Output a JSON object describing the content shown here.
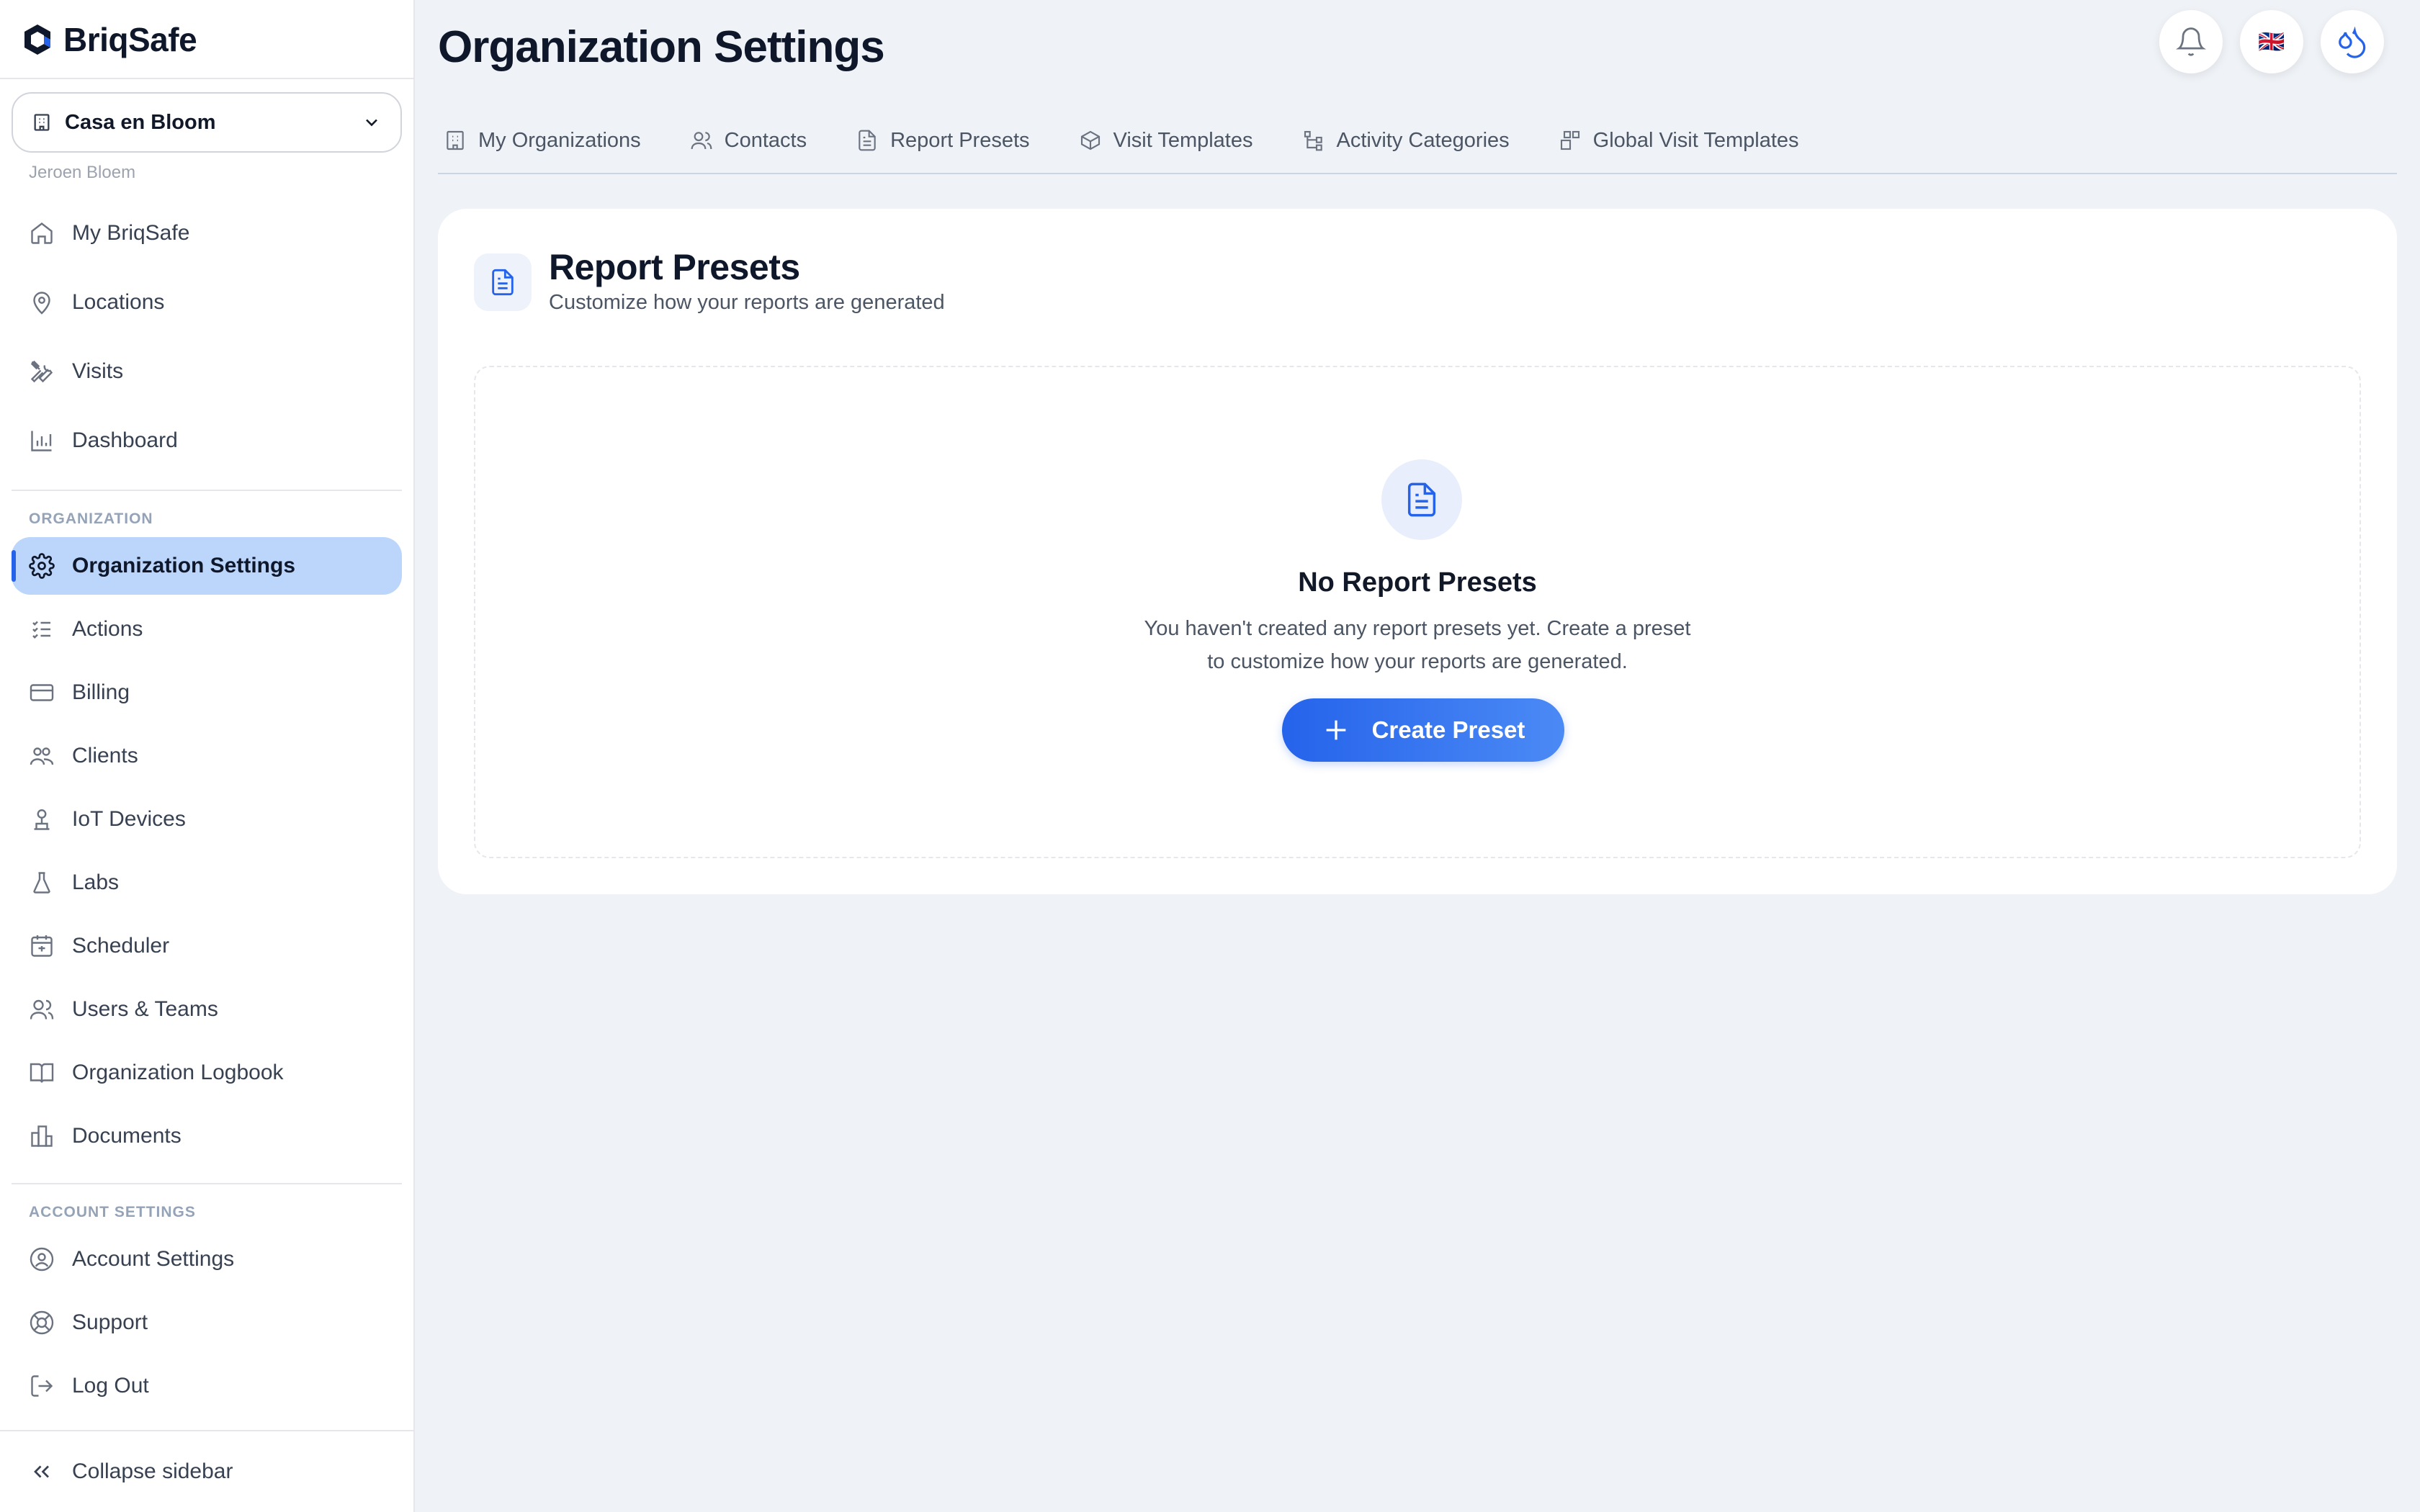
{
  "app": {
    "name": "BriqSafe"
  },
  "sidebar": {
    "org_selector": "Casa en Bloom",
    "user_name": "Jeroen Bloem",
    "main_items": [
      {
        "label": "My BriqSafe",
        "icon": "home-icon"
      },
      {
        "label": "Locations",
        "icon": "map-pin-icon"
      },
      {
        "label": "Visits",
        "icon": "tools-icon"
      },
      {
        "label": "Dashboard",
        "icon": "bar-chart-icon"
      }
    ],
    "org_section_label": "ORGANIZATION",
    "org_items": [
      {
        "label": "Organization Settings",
        "icon": "gear-icon",
        "active": true
      },
      {
        "label": "Actions",
        "icon": "checklist-icon"
      },
      {
        "label": "Billing",
        "icon": "credit-card-icon"
      },
      {
        "label": "Clients",
        "icon": "clients-icon"
      },
      {
        "label": "IoT Devices",
        "icon": "sensor-icon"
      },
      {
        "label": "Labs",
        "icon": "flask-icon"
      },
      {
        "label": "Scheduler",
        "icon": "calendar-icon"
      },
      {
        "label": "Users & Teams",
        "icon": "users-icon"
      },
      {
        "label": "Organization Logbook",
        "icon": "book-icon"
      },
      {
        "label": "Documents",
        "icon": "documents-icon"
      }
    ],
    "account_section_label": "ACCOUNT SETTINGS",
    "account_items": [
      {
        "label": "Account Settings",
        "icon": "user-circle-icon"
      },
      {
        "label": "Support",
        "icon": "lifebuoy-icon"
      },
      {
        "label": "Log Out",
        "icon": "logout-icon"
      }
    ],
    "collapse_label": "Collapse sidebar"
  },
  "header": {
    "title": "Organization Settings",
    "language_flag": "🇬🇧"
  },
  "tabs": [
    {
      "label": "My Organizations",
      "icon": "building-icon"
    },
    {
      "label": "Contacts",
      "icon": "contacts-icon"
    },
    {
      "label": "Report Presets",
      "icon": "document-icon",
      "active": true
    },
    {
      "label": "Visit Templates",
      "icon": "box-icon"
    },
    {
      "label": "Activity Categories",
      "icon": "tree-icon"
    },
    {
      "label": "Global Visit Templates",
      "icon": "grid-plus-icon"
    }
  ],
  "card": {
    "title": "Report Presets",
    "subtitle": "Customize how your reports are generated",
    "empty_title": "No Report Presets",
    "empty_desc": "You haven't created any report presets yet. Create a preset to customize how your reports are generated.",
    "create_label": "Create Preset"
  },
  "colors": {
    "accent": "#2563eb",
    "active_bg": "#bcd5fb"
  }
}
